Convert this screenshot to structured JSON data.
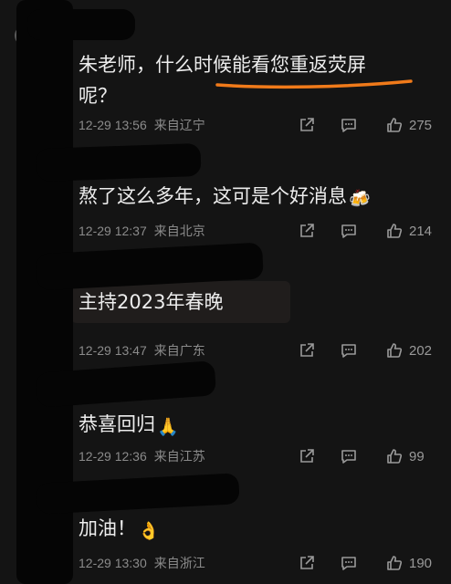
{
  "comments": [
    {
      "username_partial": "",
      "text_line1": "朱老师，什么时候能看您重返荧屏",
      "text_line2": "呢？",
      "time": "12-29 13:56",
      "location": "来自辽宁",
      "likes": "275"
    },
    {
      "text": "熬了这么多年，这可是个好消息",
      "emoji": "🍻",
      "time": "12-29 12:37",
      "location": "来自北京",
      "likes": "214"
    },
    {
      "text": "主持2023年春晚",
      "time": "12-29 13:47",
      "location": "来自广东",
      "likes": "202"
    },
    {
      "text": "恭喜回归",
      "emoji": "🙏",
      "time": "12-29 12:36",
      "location": "来自江苏",
      "likes": "99"
    },
    {
      "text": "加油！",
      "emoji": "👌",
      "time": "12-29 13:30",
      "location": "来自浙江",
      "likes": "190"
    }
  ],
  "colors": {
    "background": "#141414",
    "text": "#ededed",
    "meta": "#8b8b8b",
    "underline": "#f07a1a",
    "redaction": "#050505"
  },
  "icons": [
    "share-icon",
    "reply-icon",
    "thumbs-up-icon"
  ]
}
